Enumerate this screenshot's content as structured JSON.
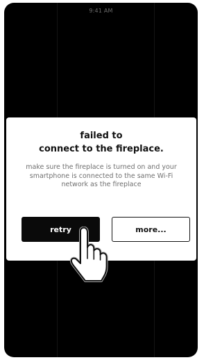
{
  "status_bar": {
    "time": "9:41 AM"
  },
  "dialog": {
    "title_line1": "failed to",
    "title_line2": "connect to the fireplace.",
    "message": "make sure the fireplace is turned on and your smartphone is connected to the same Wi-Fi network as the fireplace",
    "retry_label": "retry",
    "more_label": "more..."
  },
  "icons": {
    "pointer": "hand-pointer-icon"
  },
  "colors": {
    "backdrop": "#000000",
    "dialog_bg": "#ffffff",
    "primary_button": "#0a0a0a",
    "message_text": "#6f6f6f"
  }
}
